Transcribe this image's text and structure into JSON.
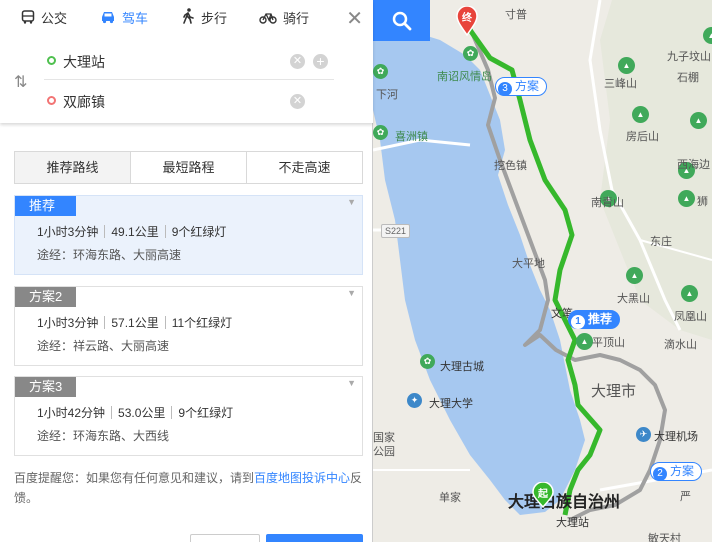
{
  "modes": [
    {
      "name": "bus",
      "label": "公交",
      "icon": "bus-icon",
      "active": false
    },
    {
      "name": "drive",
      "label": "驾车",
      "icon": "car-icon",
      "active": true
    },
    {
      "name": "walk",
      "label": "步行",
      "icon": "walk-icon",
      "active": false
    },
    {
      "name": "bike",
      "label": "骑行",
      "icon": "bike-icon",
      "active": false
    }
  ],
  "route": {
    "start": "大理站",
    "end": "双廊镇"
  },
  "tabs": [
    {
      "label": "推荐路线",
      "active": true
    },
    {
      "label": "最短路程",
      "active": false
    },
    {
      "label": "不走高速",
      "active": false
    }
  ],
  "plans": [
    {
      "badge": "推荐",
      "time": "1小时3分钟",
      "distance": "49.1公里",
      "lights": "9个红绿灯",
      "via": "途经：环海东路、大丽高速",
      "selected": true
    },
    {
      "badge": "方案2",
      "time": "1小时3分钟",
      "distance": "57.1公里",
      "lights": "11个红绿灯",
      "via": "途经：祥云路、大丽高速",
      "selected": false
    },
    {
      "badge": "方案3",
      "time": "1小时42分钟",
      "distance": "53.0公里",
      "lights": "9个红绿灯",
      "via": "途经：环海东路、大西线",
      "selected": false
    }
  ],
  "tip": {
    "prefix": "百度提醒您：如果您有任何意见和建议，请到",
    "link": "百度地图投诉中心",
    "suffix": "反馈。"
  },
  "map": {
    "labels": {
      "xiahe": "下河",
      "jizu": "寸普",
      "jiuzi": "九子坟山",
      "shige": "石棚",
      "sanfeng": "三峰山",
      "nanzhao": "南诏风情岛",
      "fanghou": "房后山",
      "xihai": "西海边",
      "xizhou": "喜洲镇",
      "wayu": "挖色镇",
      "nanqing": "南青山",
      "shi": "狮",
      "dongzhuang": "东庄",
      "s221": "S221",
      "daping": "大平地",
      "dahei": "大黑山",
      "fenghuang": "凤凰山",
      "wenbi": "文笔",
      "pingding": "平顶山",
      "dishui": "滴水山",
      "dali_gucheng": "大理古城",
      "dalishi": "大理市",
      "dali_daxue": "大理大学",
      "guojia": "国家",
      "gongyuan": "公园",
      "dali_jichang": "大理机场",
      "danjia": "单家",
      "dali_zhouzhi": "大理白族自治州",
      "dali_zhan": "大理站",
      "minsheng": "敏天村",
      "yan": "严"
    },
    "tags": {
      "recommend": "推荐",
      "plan": "方案",
      "n1": "1",
      "n2": "2",
      "n3": "3"
    },
    "markers": {
      "start": "起",
      "end": "终"
    },
    "colors": {
      "lake": "#a6c8f0",
      "route_main": "#36b82c",
      "route_alt": "#a0a0a0",
      "accent": "#3385ff"
    }
  }
}
